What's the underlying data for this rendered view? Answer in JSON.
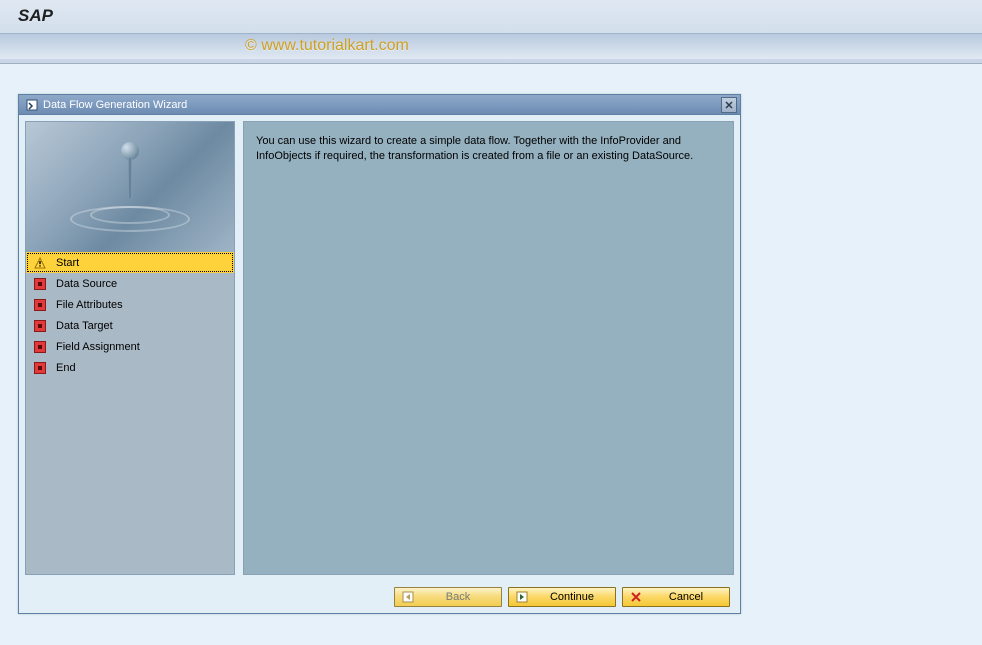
{
  "header": {
    "logo": "SAP",
    "watermark": "© www.tutorialkart.com"
  },
  "wizard": {
    "title": "Data Flow Generation Wizard",
    "description": "You can use this wizard to create a simple data flow. Together with the InfoProvider and InfoObjects if required, the transformation is created from a file or an existing DataSource.",
    "steps": [
      {
        "label": "Start",
        "status": "active"
      },
      {
        "label": "Data Source",
        "status": "pending"
      },
      {
        "label": "File Attributes",
        "status": "pending"
      },
      {
        "label": "Data Target",
        "status": "pending"
      },
      {
        "label": "Field Assignment",
        "status": "pending"
      },
      {
        "label": "End",
        "status": "pending"
      }
    ],
    "buttons": {
      "back": "Back",
      "continue": "Continue",
      "cancel": "Cancel"
    }
  }
}
